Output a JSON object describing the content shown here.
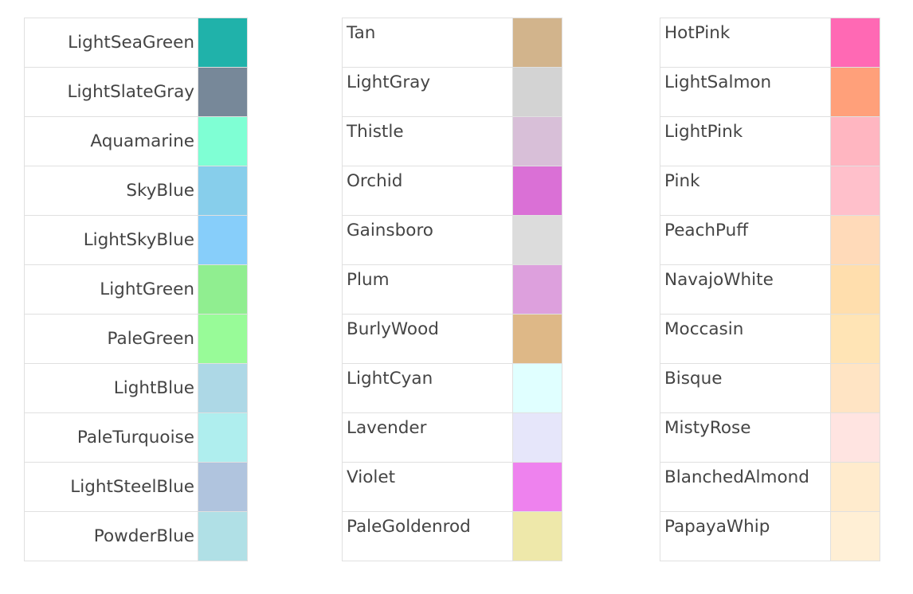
{
  "tables": [
    {
      "rows": [
        {
          "name": "LightSeaGreen",
          "color": "#20B2AA"
        },
        {
          "name": "LightSlateGray",
          "color": "#778899"
        },
        {
          "name": "Aquamarine",
          "color": "#7FFFD4"
        },
        {
          "name": "SkyBlue",
          "color": "#87CEEB"
        },
        {
          "name": "LightSkyBlue",
          "color": "#87CEFA"
        },
        {
          "name": "LightGreen",
          "color": "#90EE90"
        },
        {
          "name": "PaleGreen",
          "color": "#98FB98"
        },
        {
          "name": "LightBlue",
          "color": "#ADD8E6"
        },
        {
          "name": "PaleTurquoise",
          "color": "#AFEEEE"
        },
        {
          "name": "LightSteelBlue",
          "color": "#B0C4DE"
        },
        {
          "name": "PowderBlue",
          "color": "#B0E0E6"
        }
      ]
    },
    {
      "rows": [
        {
          "name": "Tan",
          "color": "#D2B48C"
        },
        {
          "name": "LightGray",
          "color": "#D3D3D3"
        },
        {
          "name": "Thistle",
          "color": "#D8BFD8"
        },
        {
          "name": "Orchid",
          "color": "#DA70D6"
        },
        {
          "name": "Gainsboro",
          "color": "#DCDCDC"
        },
        {
          "name": "Plum",
          "color": "#DDA0DD"
        },
        {
          "name": "BurlyWood",
          "color": "#DEB887"
        },
        {
          "name": "LightCyan",
          "color": "#E0FFFF"
        },
        {
          "name": "Lavender",
          "color": "#E6E6FA"
        },
        {
          "name": "Violet",
          "color": "#EE82EE"
        },
        {
          "name": "PaleGoldenrod",
          "color": "#EEE8AA"
        }
      ]
    },
    {
      "rows": [
        {
          "name": "HotPink",
          "color": "#FF69B4"
        },
        {
          "name": "LightSalmon",
          "color": "#FFA07A"
        },
        {
          "name": "LightPink",
          "color": "#FFB6C1"
        },
        {
          "name": "Pink",
          "color": "#FFC0CB"
        },
        {
          "name": "PeachPuff",
          "color": "#FFDAB9"
        },
        {
          "name": "NavajoWhite",
          "color": "#FFDEAD"
        },
        {
          "name": "Moccasin",
          "color": "#FFE4B5"
        },
        {
          "name": "Bisque",
          "color": "#FFE4C4"
        },
        {
          "name": "MistyRose",
          "color": "#FFE4E1"
        },
        {
          "name": "BlanchedAlmond",
          "color": "#FFEBCD"
        },
        {
          "name": "PapayaWhip",
          "color": "#FFEFD5"
        }
      ]
    }
  ]
}
